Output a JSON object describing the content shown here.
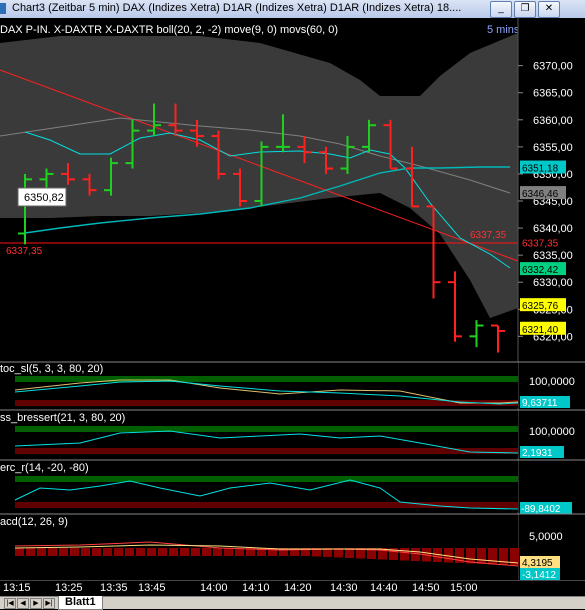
{
  "window": {
    "title": "Chart3 (Zeitbar 5 min)  DAX (Indizes Xetra) D1AR (Indizes Xetra) D1AR (Indizes Xetra) 18....",
    "minimize": "_",
    "restore": "❐",
    "close": "✕"
  },
  "main_panel": {
    "label": "DAX P-IN. X-DAXTR X-DAXTR boll(20, 2, -2) move(9, 0) movs(60, 0)",
    "period": "5 mins",
    "y_ticks": [
      "6370,00",
      "6365,00",
      "6360,00",
      "6355,00",
      "6350,00",
      "6345,00",
      "6340,00",
      "6335,00",
      "6330,00",
      "6325,00",
      "6320,00"
    ],
    "price_tags": [
      {
        "text": "6351,18",
        "bg": "#00c8c8",
        "fg": "#000000"
      },
      {
        "text": "6346,46",
        "bg": "#808080",
        "fg": "#000000"
      },
      {
        "text": "6337,35",
        "bg": "#000000",
        "fg": "#ff3030"
      },
      {
        "text": "6332,42",
        "bg": "#00d080",
        "fg": "#000000"
      },
      {
        "text": "6325,76",
        "bg": "#ffff00",
        "fg": "#000000"
      },
      {
        "text": "6321,40",
        "bg": "#ffff00",
        "fg": "#000000"
      }
    ],
    "hline_label_left": "6337,35",
    "hline_label_right": "6337,35",
    "hover_box": "6350,82"
  },
  "stoch_panel": {
    "label": "toc_sl(5, 3, 3, 80, 20)",
    "tick": "100,0000",
    "value_tag": "9,63711"
  },
  "bressert_panel": {
    "label": "ss_bressert(21, 3, 80, 20)",
    "tick": "100,0000",
    "value_tag": "2,1931"
  },
  "willr_panel": {
    "label": "erc_r(14, -20, -80)",
    "value_tag": "-89,8402"
  },
  "macd_panel": {
    "label": "acd(12, 26, 9)",
    "tick": "5,0000",
    "value_tag_1": "4,3195",
    "value_tag_2": "-3,1412"
  },
  "x_axis": [
    "13:15",
    "13:25",
    "13:35",
    "13:45",
    "14:00",
    "14:10",
    "14:20",
    "14:30",
    "14:40",
    "14:50",
    "15:00"
  ],
  "status": {
    "tab": "Blatt1"
  },
  "chart_data": {
    "type": "candlestick",
    "x": [
      "13:15",
      "13:20",
      "13:25",
      "13:30",
      "13:35",
      "13:40",
      "13:45",
      "13:50",
      "13:55",
      "14:00",
      "14:05",
      "14:10",
      "14:15",
      "14:20",
      "14:25",
      "14:30",
      "14:35",
      "14:40",
      "14:45",
      "14:50",
      "14:55",
      "15:00",
      "15:05"
    ],
    "ohlc": [
      [
        6339,
        6350,
        6337,
        6349
      ],
      [
        6349,
        6351,
        6346,
        6350
      ],
      [
        6350,
        6352,
        6348,
        6349
      ],
      [
        6349,
        6350,
        6346,
        6347
      ],
      [
        6347,
        6353,
        6346,
        6352
      ],
      [
        6352,
        6360,
        6351,
        6358
      ],
      [
        6358,
        6363,
        6357,
        6359
      ],
      [
        6359,
        6363,
        6357,
        6358
      ],
      [
        6358,
        6360,
        6355,
        6357
      ],
      [
        6357,
        6358,
        6349,
        6350
      ],
      [
        6350,
        6351,
        6344,
        6345
      ],
      [
        6345,
        6356,
        6344,
        6355
      ],
      [
        6355,
        6361,
        6354,
        6355
      ],
      [
        6355,
        6357,
        6352,
        6354
      ],
      [
        6354,
        6355,
        6350,
        6351
      ],
      [
        6351,
        6357,
        6350,
        6355
      ],
      [
        6355,
        6360,
        6354,
        6359
      ],
      [
        6359,
        6360,
        6351,
        6351
      ],
      [
        6351,
        6355,
        6344,
        6344
      ],
      [
        6344,
        6344,
        6327,
        6330
      ],
      [
        6330,
        6332,
        6319,
        6320
      ],
      [
        6320,
        6323,
        6318,
        6322
      ],
      [
        6322,
        6322,
        6317,
        6321
      ]
    ],
    "hline": 6337.35,
    "ylim": [
      6316,
      6374
    ],
    "series": [
      {
        "name": "boll upper",
        "color": "#404040"
      },
      {
        "name": "boll lower",
        "color": "#404040"
      },
      {
        "name": "move(9)",
        "color": "#00e0e0"
      },
      {
        "name": "movs(60)",
        "color": "#00c8c8"
      },
      {
        "name": "trend",
        "color": "#ff2020"
      }
    ]
  }
}
